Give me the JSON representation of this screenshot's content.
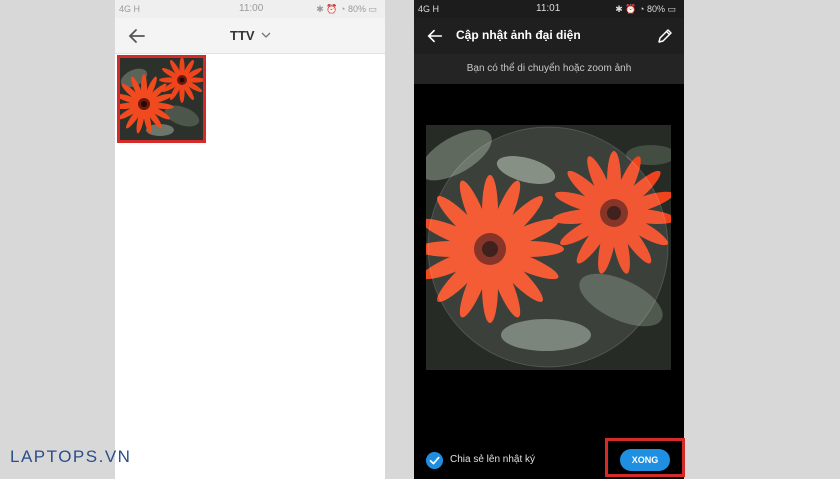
{
  "left_screen": {
    "status_bar": {
      "signal": "4G H",
      "time": "11:00",
      "battery": "80%"
    },
    "header": {
      "title": "TTV"
    }
  },
  "right_screen": {
    "status_bar": {
      "signal": "4G H",
      "time": "11:01",
      "battery": "80%"
    },
    "header": {
      "title": "Cập nhật ảnh đại diện"
    },
    "hint": "Bạn có thể di chuyển hoặc zoom ảnh",
    "share_label": "Chia sẻ lên nhật ký",
    "share_checked": true,
    "done_label": "XONG"
  },
  "watermark": "LAPTOPS.VN",
  "colors": {
    "highlight": "#d42a2a",
    "accent": "#1e8fe1",
    "petal": "#f0451c"
  }
}
